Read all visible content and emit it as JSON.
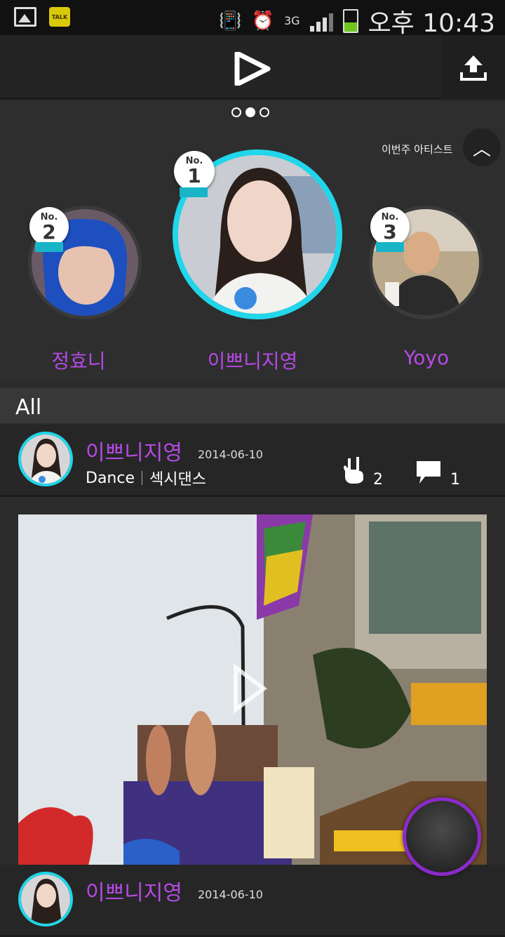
{
  "status_bar": {
    "time": "오후 10:43",
    "network": "3G",
    "talk_label": "TALK",
    "icons": [
      "gallery-icon",
      "kakaotalk-icon",
      "vibrate-mute-icon",
      "alarm-icon",
      "network-3g-icon",
      "signal-icon",
      "battery-icon"
    ]
  },
  "header": {
    "logo_icon": "play-logo-icon",
    "upload_icon": "upload-icon"
  },
  "weekly": {
    "label": "이번주 아티스트",
    "page_indicator": {
      "count": 3,
      "active": 1
    },
    "artists": [
      {
        "rank_no": "No.",
        "rank": "2",
        "name": "정효니"
      },
      {
        "rank_no": "No.",
        "rank": "1",
        "name": "이쁘니지영"
      },
      {
        "rank_no": "No.",
        "rank": "3",
        "name": "Yoyo"
      }
    ]
  },
  "feed": {
    "section_title": "All",
    "posts": [
      {
        "author": "이쁘니지영",
        "date": "2014-06-10",
        "category": "Dance",
        "title": "섹시댄스",
        "likes": "2",
        "comments": "1"
      },
      {
        "author": "이쁘니지영",
        "date": "2014-06-10"
      }
    ]
  },
  "colors": {
    "accent_purple": "#b44ae4",
    "accent_cyan": "#20d6ea",
    "fab_ring": "#8a2bc9",
    "background": "#2b2b2b"
  }
}
